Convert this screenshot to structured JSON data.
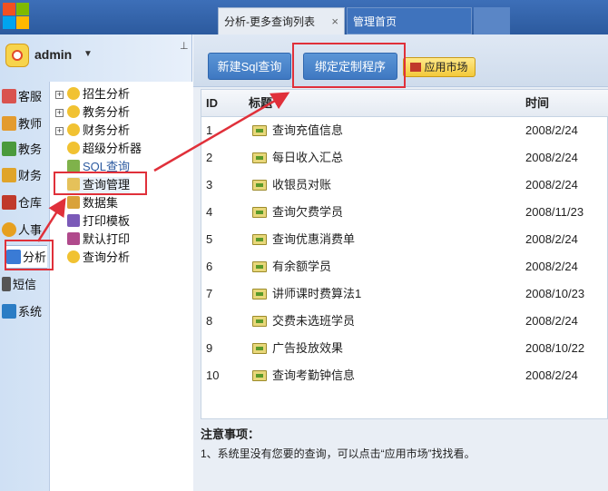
{
  "tabs": {
    "active": "分析-更多查询列表",
    "active_close": "×",
    "inactive": "管理首页"
  },
  "user": {
    "name": "admin",
    "caret": "▼",
    "pin": "⊥"
  },
  "modules": [
    {
      "label": "客服",
      "icon_color": "#d9534f"
    },
    {
      "label": "教师",
      "icon_color": "#e39b2e"
    },
    {
      "label": "教务",
      "icon_color": "#4a9a3c"
    },
    {
      "label": "财务",
      "icon_color": "#e0a42a"
    },
    {
      "label": "仓库",
      "icon_color": "#c0392b"
    },
    {
      "label": "人事",
      "icon_color": "#e6a020"
    },
    {
      "label": "分析",
      "icon_color": "#3a7bd5"
    },
    {
      "label": "短信",
      "icon_color": "#555555"
    },
    {
      "label": "系统",
      "icon_color": "#2b7dc5"
    }
  ],
  "tree": [
    {
      "label": "招生分析",
      "expander": "+"
    },
    {
      "label": "教务分析",
      "expander": "+"
    },
    {
      "label": "财务分析",
      "expander": "+"
    },
    {
      "label": "超级分析器",
      "expander": ""
    },
    {
      "label": "SQL查询",
      "expander": ""
    },
    {
      "label": "查询管理",
      "expander": ""
    },
    {
      "label": "数据集",
      "expander": ""
    },
    {
      "label": "打印模板",
      "expander": ""
    },
    {
      "label": "默认打印",
      "expander": ""
    },
    {
      "label": "查询分析",
      "expander": ""
    }
  ],
  "toolbar": {
    "new_sql": "新建Sql查询",
    "bind_program": "绑定定制程序",
    "app_market": "应用市场"
  },
  "table": {
    "headers": {
      "id": "ID",
      "title": "标题",
      "time": "时间"
    },
    "rows": [
      {
        "id": "1",
        "title": "查询充值信息",
        "time": "2008/2/24"
      },
      {
        "id": "2",
        "title": "每日收入汇总",
        "time": "2008/2/24"
      },
      {
        "id": "3",
        "title": "收银员对账",
        "time": "2008/2/24"
      },
      {
        "id": "4",
        "title": "查询欠费学员",
        "time": "2008/11/23"
      },
      {
        "id": "5",
        "title": "查询优惠消费单",
        "time": "2008/2/24"
      },
      {
        "id": "6",
        "title": "有余额学员",
        "time": "2008/2/24"
      },
      {
        "id": "7",
        "title": "讲师课时费算法1",
        "time": "2008/10/23"
      },
      {
        "id": "8",
        "title": "交费未选班学员",
        "time": "2008/2/24"
      },
      {
        "id": "9",
        "title": "广告投放效果",
        "time": "2008/10/22"
      },
      {
        "id": "10",
        "title": "查询考勤钟信息",
        "time": "2008/2/24"
      }
    ]
  },
  "notes": {
    "title": "注意事项：",
    "text": "1、系统里没有您要的查询，可以点击“应用市场”找找看。"
  },
  "colors": {
    "highlight": "#e0303a",
    "accent": "#3f78c2"
  }
}
